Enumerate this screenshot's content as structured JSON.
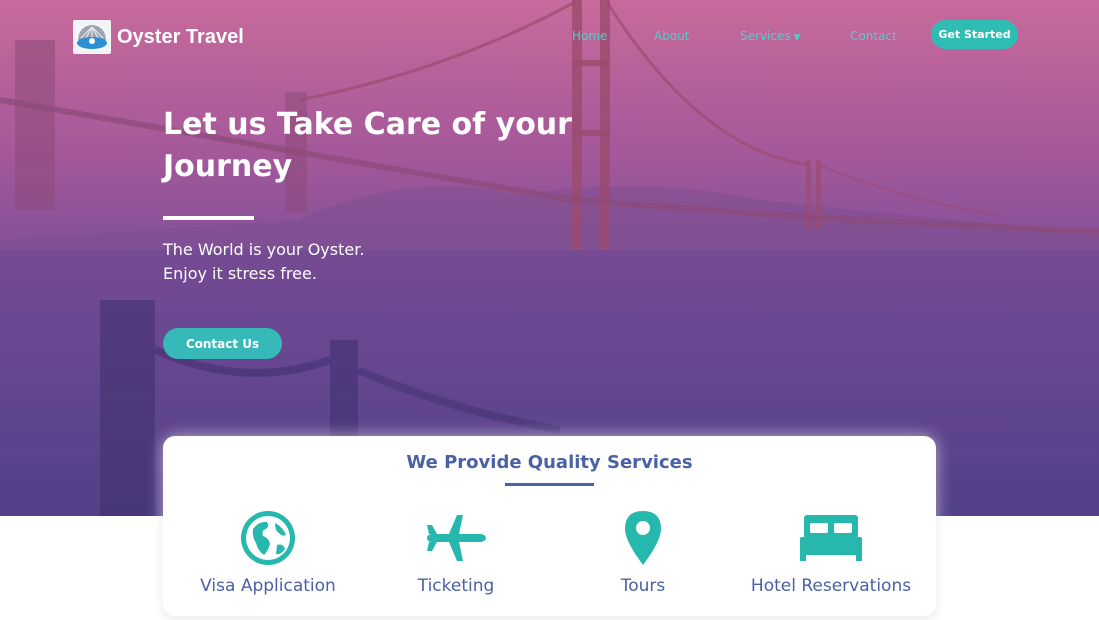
{
  "brand": {
    "name": "Oyster Travel"
  },
  "nav": {
    "items": [
      {
        "label": "Home"
      },
      {
        "label": "About"
      },
      {
        "label": "Services"
      },
      {
        "label": "Contact"
      }
    ],
    "cta": "Get Started"
  },
  "hero": {
    "title": "Let us Take Care of your Journey",
    "subtitle_line1": "The World is your Oyster.",
    "subtitle_line2": "Enjoy it stress free.",
    "button": "Contact Us"
  },
  "services": {
    "title": "We Provide Quality Services",
    "items": [
      {
        "label": "Visa Application",
        "icon": "globe-icon"
      },
      {
        "label": "Ticketing",
        "icon": "airplane-icon"
      },
      {
        "label": "Tours",
        "icon": "map-pin-icon"
      },
      {
        "label": "Hotel Reservations",
        "icon": "bed-icon"
      }
    ]
  },
  "colors": {
    "accent": "#2fbdb3",
    "heading": "#4a61a6",
    "hero_top": "#c86a9b",
    "hero_bottom": "#2e3583"
  }
}
